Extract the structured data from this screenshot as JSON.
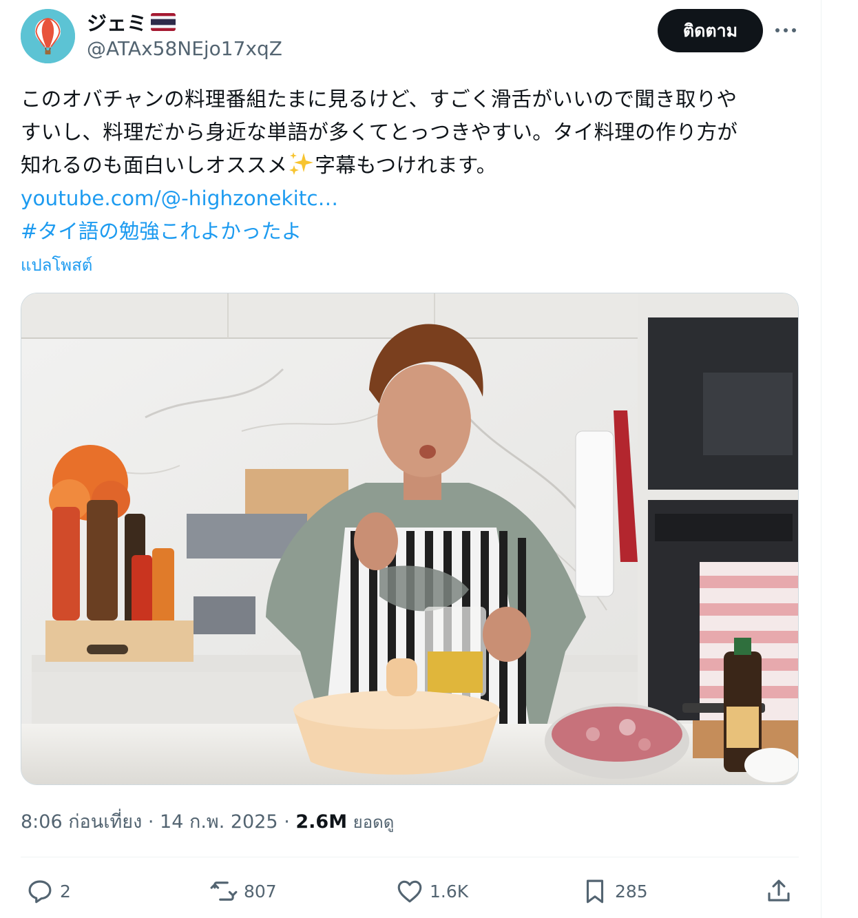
{
  "author": {
    "display_name": "ジェミ",
    "flag_icon": "thailand-flag-icon",
    "handle": "@ATAx58NEjo17xqZ",
    "avatar_icon": "hot-air-balloon-icon",
    "avatar_color": "#5cc3d4"
  },
  "header": {
    "follow_label": "ติดตาม",
    "more_icon": "more-horizontal-icon"
  },
  "post": {
    "text_lines": [
      "このオバチャンの料理番組たまに見るけど、すごく滑舌がいいので聞き取りや",
      "すいし、料理だから身近な単語が多くてとっつきやすい。タイ料理の作り方が",
      "知れるのも面白いしオススメ"
    ],
    "text_after_emoji": "字幕もつけれます。",
    "emoji_icon": "sparkles-icon",
    "link_text": "youtube.com/@-highzonekitc…",
    "hashtag": "#タイ語の勉強これよかったよ",
    "translate_label": "แปลโพสต์"
  },
  "media": {
    "type": "video-thumbnail"
  },
  "meta": {
    "time": "8:06 ก่อนเที่ยง",
    "separator": "·",
    "date": "14 ก.พ. 2025",
    "views_count": "2.6M",
    "views_label": "ยอดดู"
  },
  "actions": {
    "reply": {
      "icon": "reply-icon",
      "count": "2"
    },
    "repost": {
      "icon": "repost-icon",
      "count": "807"
    },
    "like": {
      "icon": "heart-icon",
      "count": "1.6K"
    },
    "bookmark": {
      "icon": "bookmark-icon",
      "count": "285"
    },
    "share": {
      "icon": "share-icon"
    }
  },
  "colors": {
    "link_blue": "#1d9bf0",
    "muted_gray": "#536471",
    "text_black": "#0f1419"
  }
}
